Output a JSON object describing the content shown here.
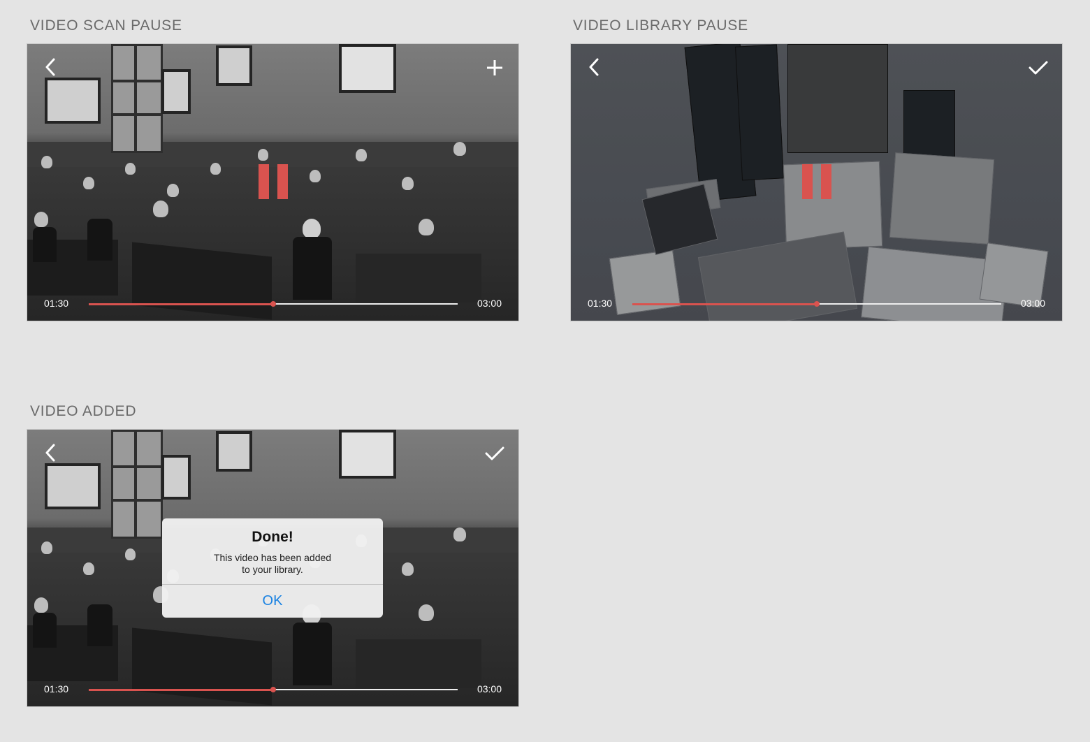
{
  "panels": [
    {
      "title": "VIDEO SCAN PAUSE",
      "scene": "classroom-photo",
      "action_icon": "plus-icon",
      "state": "paused",
      "time_current": "01:30",
      "time_total": "03:00",
      "progress": 0.5
    },
    {
      "title": "VIDEO LIBRARY PAUSE",
      "scene": "library-books-photo",
      "action_icon": "checkmark-icon",
      "state": "paused",
      "time_current": "01:30",
      "time_total": "03:00",
      "progress": 0.5
    },
    {
      "title": "VIDEO ADDED",
      "scene": "classroom-photo",
      "action_icon": "checkmark-icon",
      "state": "alert",
      "time_current": "01:30",
      "time_total": "03:00",
      "progress": 0.5,
      "alert": {
        "title": "Done!",
        "message_line1": "This video has been added",
        "message_line2": "to your library.",
        "button": "OK"
      }
    }
  ],
  "colors": {
    "background": "#e4e4e4",
    "title_text": "#6a6a6a",
    "accent_red": "#d9534f",
    "alert_button_blue": "#1a82e2",
    "controls_white": "#ffffff"
  },
  "icons": {
    "back": "chevron-left-icon",
    "pause": "pause-icon"
  }
}
